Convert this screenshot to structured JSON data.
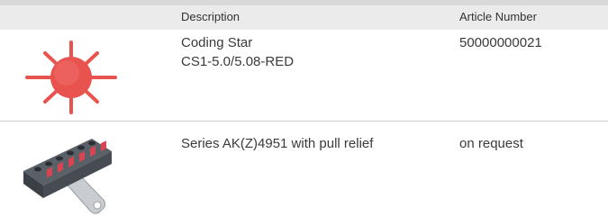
{
  "table": {
    "headers": {
      "description": "Description",
      "article_number": "Article Number"
    },
    "rows": [
      {
        "image": "coding-star-icon",
        "description_line1": "Coding Star",
        "description_line2": "CS1-5.0/5.08-RED",
        "article_number": "50000000021"
      },
      {
        "image": "terminal-block-connector-image",
        "description_line1": "Series AK(Z)4951 with pull relief",
        "article_number": "on request"
      }
    ]
  },
  "colors": {
    "header_background": "#ebebeb",
    "star_red": "#e8524f",
    "connector_body": "#4a4f55",
    "connector_red": "#d64550"
  }
}
